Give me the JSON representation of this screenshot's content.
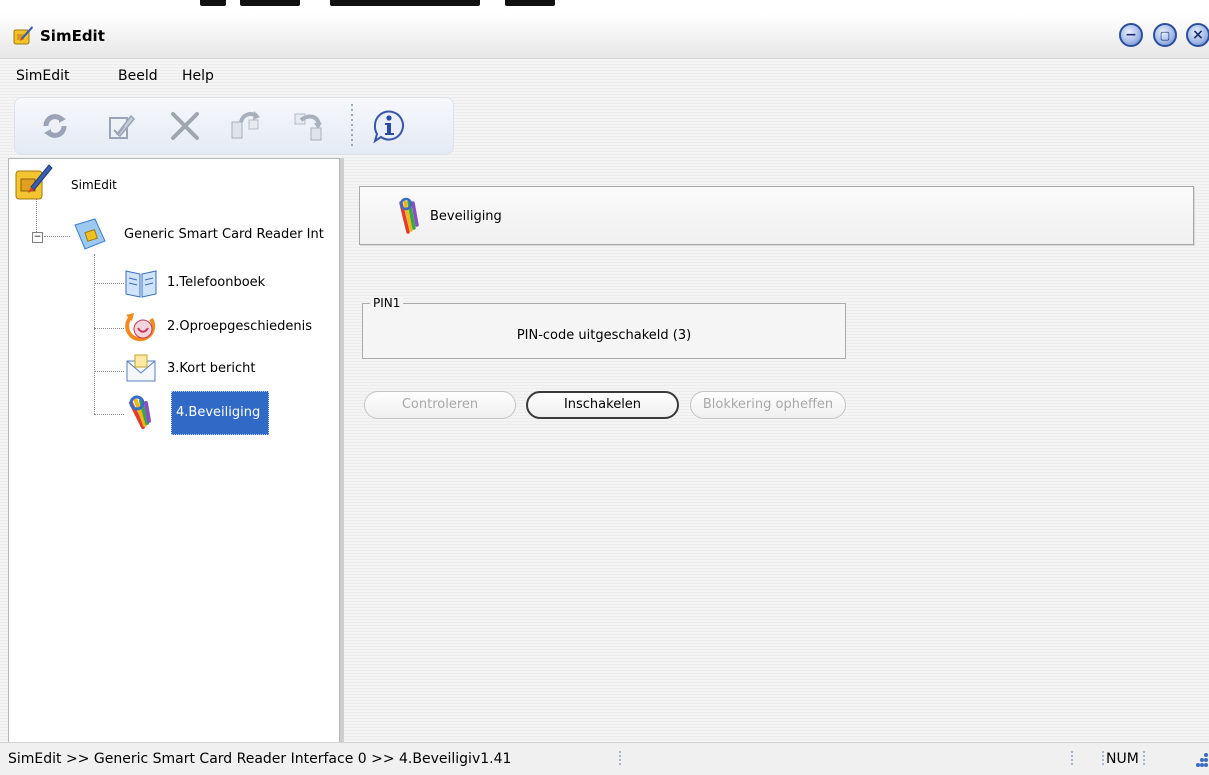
{
  "window": {
    "title": "SimEdit"
  },
  "menu": {
    "items": [
      "SimEdit",
      "Beeld",
      "Help"
    ]
  },
  "toolbar": {
    "buttons": [
      {
        "icon": "refresh-icon"
      },
      {
        "icon": "edit-icon"
      },
      {
        "icon": "delete-icon"
      },
      {
        "icon": "copy-icon"
      },
      {
        "icon": "paste-icon"
      },
      {
        "icon": "info-icon"
      }
    ]
  },
  "tree": {
    "root": "SimEdit",
    "reader": "Generic Smart Card Reader Int",
    "items": [
      "1.Telefoonboek",
      "2.Oproepgeschiedenis",
      "3.Kort bericht",
      "4.Beveiliging"
    ],
    "selected_index": 3
  },
  "content": {
    "header": "Beveiliging",
    "group_title": "PIN1",
    "pin_status": "PIN-code uitgeschakeld (3)",
    "buttons": {
      "check": "Controleren",
      "enable": "Inschakelen",
      "unblock": "Blokkering opheffen"
    }
  },
  "status": {
    "path": "SimEdit  >>  Generic Smart Card Reader Interface 0  >>  4.Beveiligi",
    "version": "v1.41",
    "num": "NUM"
  },
  "colors": {
    "selection": "#3169c6",
    "window_button": "#2c4f9c"
  }
}
